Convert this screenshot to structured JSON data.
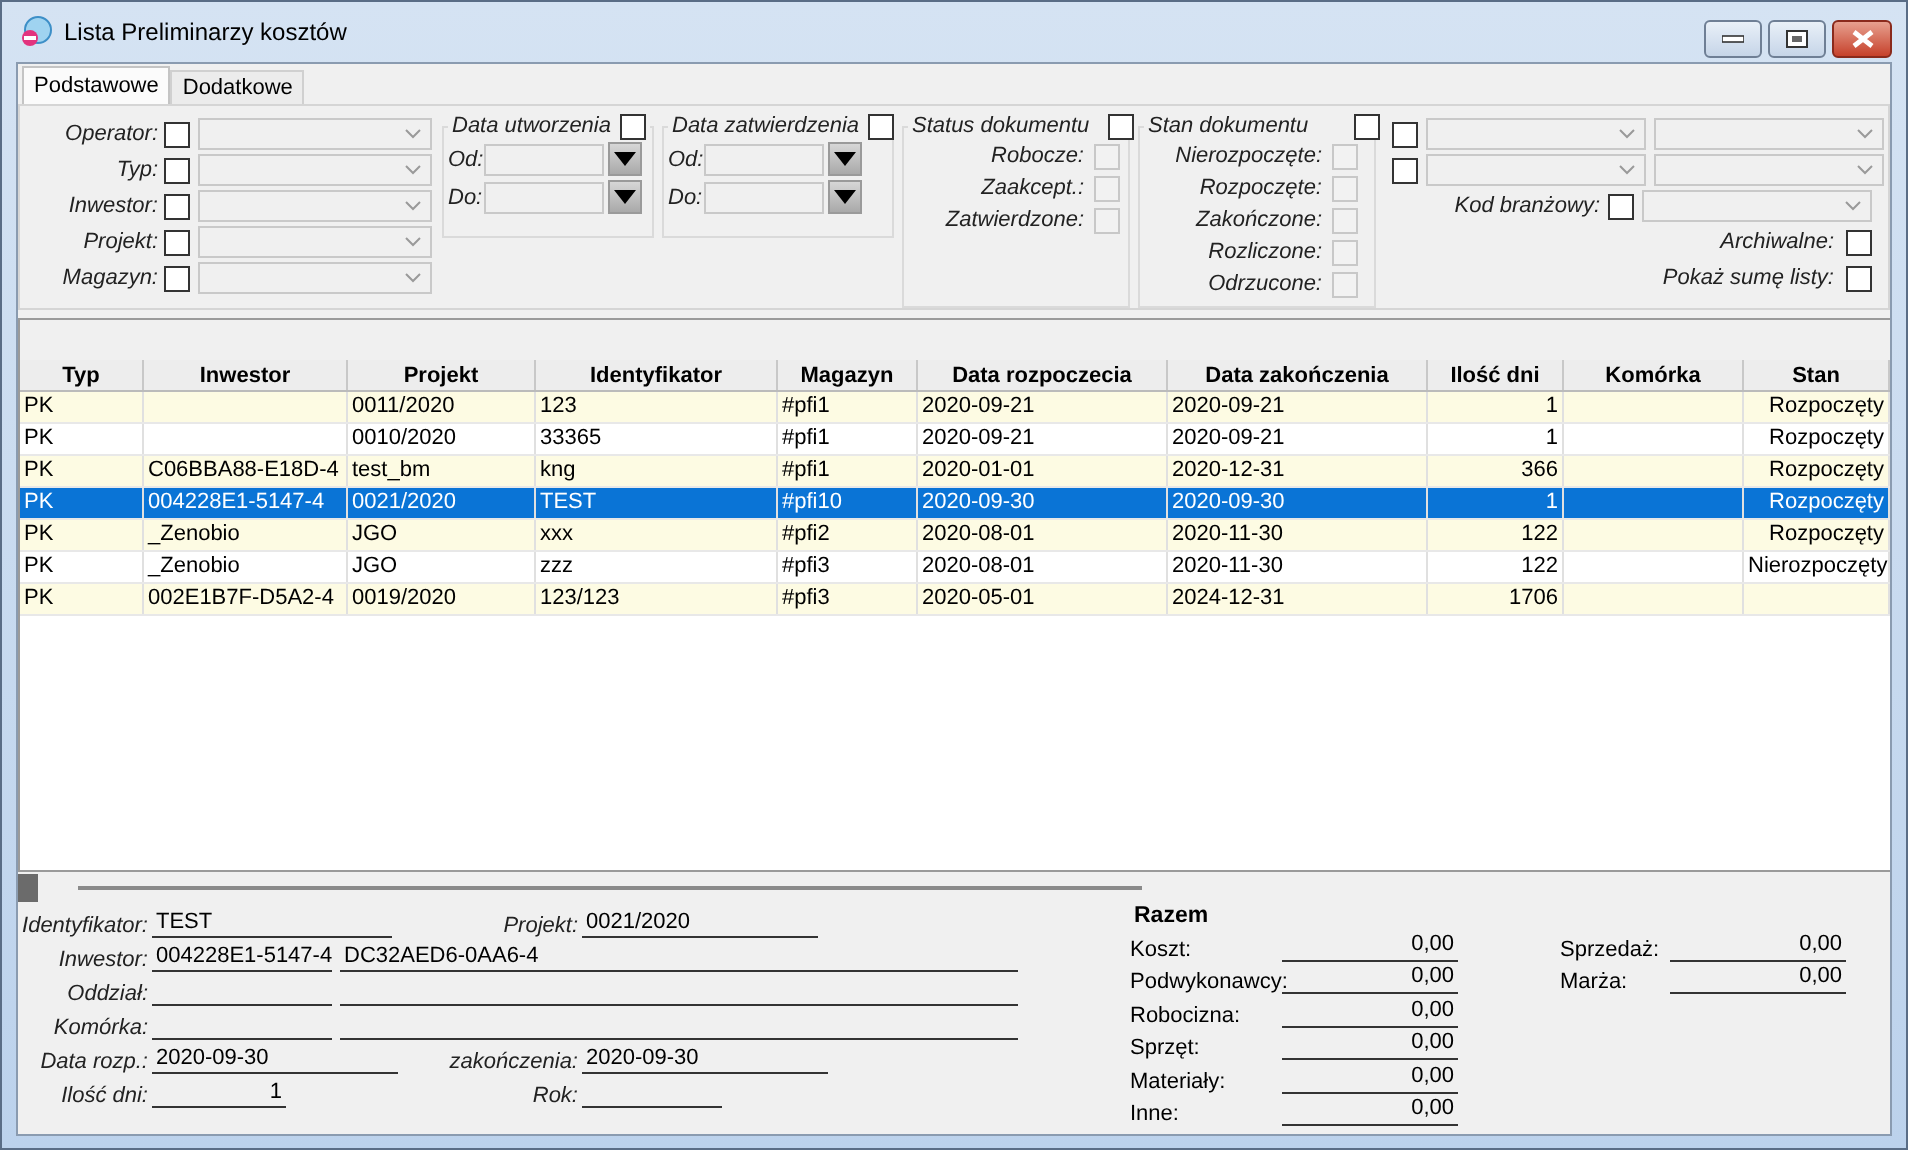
{
  "window": {
    "title": "Lista Preliminarzy kosztów"
  },
  "tabs": [
    {
      "label": "Podstawowe",
      "selected": true
    },
    {
      "label": "Dodatkowe",
      "selected": false
    }
  ],
  "filters": {
    "fields": [
      {
        "label": "Operator:",
        "checked": false
      },
      {
        "label": "Typ:",
        "checked": false
      },
      {
        "label": "Inwestor:",
        "checked": false
      },
      {
        "label": "Projekt:",
        "checked": false
      },
      {
        "label": "Magazyn:",
        "checked": false
      }
    ],
    "date_groups": [
      {
        "title": "Data utworzenia",
        "checked": false,
        "fields": [
          {
            "label": "Od:"
          },
          {
            "label": "Do:"
          }
        ]
      },
      {
        "title": "Data zatwierdzenia",
        "checked": false,
        "fields": [
          {
            "label": "Od:"
          },
          {
            "label": "Do:"
          }
        ]
      }
    ],
    "status_groups": [
      {
        "title": "Status dokumentu",
        "checked": false,
        "options": [
          {
            "label": "Robocze:",
            "checked": false,
            "disabled": true
          },
          {
            "label": "Zaakcept.:",
            "checked": false,
            "disabled": true
          },
          {
            "label": "Zatwierdzone:",
            "checked": false,
            "disabled": true
          }
        ]
      },
      {
        "title": "Stan dokumentu",
        "checked": false,
        "options": [
          {
            "label": "Nierozpoczęte:",
            "checked": false,
            "disabled": true
          },
          {
            "label": "Rozpoczęte:",
            "checked": false,
            "disabled": true
          },
          {
            "label": "Zakończone:",
            "checked": false,
            "disabled": true
          },
          {
            "label": "Rozliczone:",
            "checked": false,
            "disabled": true
          },
          {
            "label": "Odrzucone:",
            "checked": false,
            "disabled": true
          }
        ]
      }
    ],
    "extra_rows": [
      {
        "checked": false
      },
      {
        "checked": false
      }
    ],
    "kod_branzowy": {
      "label": "Kod branżowy:",
      "checked": false
    },
    "options": [
      {
        "label": "Archiwalne:",
        "checked": false
      },
      {
        "label": "Pokaż sumę listy:",
        "checked": false
      }
    ]
  },
  "table": {
    "columns": [
      "Typ",
      "Inwestor",
      "Projekt",
      "Identyfikator",
      "Magazyn",
      "Data rozpoczecia",
      "Data zakończenia",
      "Ilość dni",
      "Komórka",
      "Stan"
    ],
    "rows": [
      {
        "selected": false,
        "cells": {
          "typ": "PK",
          "projekt": "0011/2020",
          "identyfikator": "123",
          "magazyn": "#pfi1",
          "data_rozpoczecia": "2020-09-21",
          "data_zakonczenia": "2020-09-21",
          "ilosc_dni": "1",
          "stan": "Rozpoczęty"
        }
      },
      {
        "selected": false,
        "cells": {
          "typ": "PK",
          "projekt": "0010/2020",
          "identyfikator": "33365",
          "magazyn": "#pfi1",
          "data_rozpoczecia": "2020-09-21",
          "data_zakonczenia": "2020-09-21",
          "ilosc_dni": "1",
          "stan": "Rozpoczęty"
        }
      },
      {
        "selected": false,
        "cells": {
          "typ": "PK",
          "inwestor": "C06BBA88-E18D-4",
          "projekt": "test_bm",
          "identyfikator": "kng",
          "magazyn": "#pfi1",
          "data_rozpoczecia": "2020-01-01",
          "data_zakonczenia": "2020-12-31",
          "ilosc_dni": "366",
          "stan": "Rozpoczęty"
        }
      },
      {
        "selected": true,
        "cells": {
          "typ": "PK",
          "inwestor": "004228E1-5147-4",
          "projekt": "0021/2020",
          "identyfikator": "TEST",
          "magazyn": "#pfi10",
          "data_rozpoczecia": "2020-09-30",
          "data_zakonczenia": "2020-09-30",
          "ilosc_dni": "1",
          "stan": "Rozpoczęty"
        }
      },
      {
        "selected": false,
        "cells": {
          "typ": "PK",
          "inwestor": "_Zenobio",
          "projekt": "JGO",
          "identyfikator": "xxx",
          "magazyn": "#pfi2",
          "data_rozpoczecia": "2020-08-01",
          "data_zakonczenia": "2020-11-30",
          "ilosc_dni": "122",
          "stan": "Rozpoczęty"
        }
      },
      {
        "selected": false,
        "cells": {
          "typ": "PK",
          "inwestor": "_Zenobio",
          "projekt": "JGO",
          "identyfikator": "zzz",
          "magazyn": "#pfi3",
          "data_rozpoczecia": "2020-08-01",
          "data_zakonczenia": "2020-11-30",
          "ilosc_dni": "122",
          "stan": "Nierozpoczęty"
        }
      },
      {
        "selected": false,
        "cells": {
          "typ": "PK",
          "inwestor": "002E1B7F-D5A2-4",
          "projekt": "0019/2020",
          "identyfikator": "123/123",
          "magazyn": "#pfi3",
          "data_rozpoczecia": "2020-05-01",
          "data_zakonczenia": "2024-12-31",
          "ilosc_dni": "1706"
        }
      }
    ]
  },
  "details": {
    "fields": [
      {
        "label": "Identyfikator:",
        "values": [
          "TEST"
        ]
      },
      {
        "label": "Projekt:",
        "values": [
          "0021/2020"
        ]
      },
      {
        "label": "Inwestor:",
        "values": [
          "004228E1-5147-4",
          "DC32AED6-0AA6-4"
        ]
      },
      {
        "label": "Oddział:"
      },
      {
        "label": "Komórka:"
      },
      {
        "label": "Data rozp.:",
        "values": [
          "2020-09-30"
        ]
      },
      {
        "label": "zakończenia:",
        "values": [
          "2020-09-30"
        ]
      },
      {
        "label": "Ilość dni:",
        "values": [
          "1"
        ]
      },
      {
        "label": "Rok:"
      }
    ]
  },
  "totals": {
    "title": "Razem",
    "columns": [
      [
        {
          "label": "Koszt:",
          "value": "0,00"
        },
        {
          "label": "Podwykonawcy:",
          "value": "0,00"
        },
        {
          "label": "Robocizna:",
          "value": "0,00"
        },
        {
          "label": "Sprzęt:",
          "value": "0,00"
        },
        {
          "label": "Materiały:",
          "value": "0,00"
        },
        {
          "label": "Inne:",
          "value": "0,00"
        }
      ],
      [
        {
          "label": "Sprzedaż:",
          "value": "0,00"
        },
        {
          "label": "Marża:",
          "value": "0,00"
        }
      ]
    ]
  }
}
